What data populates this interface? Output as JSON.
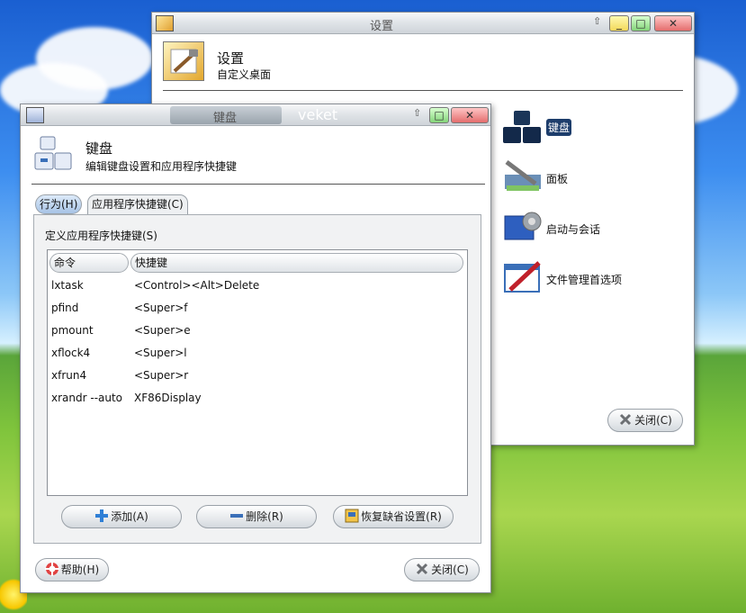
{
  "settings_window": {
    "title": "设置",
    "header_title": "设置",
    "header_subtitle": "自定义桌面",
    "categories": [
      {
        "label": "键盘",
        "icon": "keyboard-icon",
        "selected": true
      },
      {
        "label": "面板",
        "icon": "panel-tools-icon"
      },
      {
        "label": "启动与会话",
        "icon": "session-gear-icon"
      },
      {
        "label": "文件管理首选项",
        "icon": "file-manager-icon"
      }
    ],
    "close_label": "关闭(C)"
  },
  "keyboard_window": {
    "title": "键盘",
    "title_extra": "veket",
    "header_title": "键盘",
    "header_subtitle": "编辑键盘设置和应用程序快捷键",
    "tabs": [
      "行为(H)",
      "应用程序快捷键(C)"
    ],
    "section_label": "定义应用程序快捷键(S)",
    "columns": [
      "命令",
      "快捷键"
    ],
    "rows": [
      {
        "command": "lxtask",
        "shortcut": "<Control><Alt>Delete"
      },
      {
        "command": "pfind",
        "shortcut": "<Super>f"
      },
      {
        "command": "pmount",
        "shortcut": "<Super>e"
      },
      {
        "command": "xflock4",
        "shortcut": "<Super>l"
      },
      {
        "command": "xfrun4",
        "shortcut": "<Super>r"
      },
      {
        "command": "xrandr --auto",
        "shortcut": "XF86Display"
      }
    ],
    "add_label": "添加(A)",
    "remove_label": "删除(R)",
    "restore_label": "恢复缺省设置(R)",
    "help_label": "帮助(H)",
    "close_label": "关闭(C)"
  },
  "colors": {
    "selection": "#1d3d6b",
    "add": "#2f7fd6",
    "remove": "#3a6fb8",
    "close_x": "#6c6f73"
  }
}
